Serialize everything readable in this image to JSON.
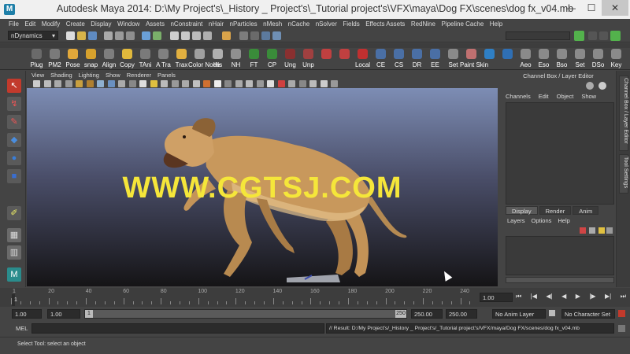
{
  "window": {
    "title": "Autodesk Maya 2014: D:\\My Project's\\_History _ Project's\\_Tutorial project's\\VFX\\maya\\Dog FX\\scenes\\dog fx_v04.mb",
    "minimize": "—",
    "maximize": "☐",
    "close": "✕"
  },
  "menubar": [
    "File",
    "Edit",
    "Modify",
    "Create",
    "Display",
    "Window",
    "Assets",
    "nConstraint",
    "nHair",
    "nParticles",
    "nMesh",
    "nCache",
    "nSolver",
    "Fields",
    "Effects Assets",
    "RedNine",
    "Pipeline Cache",
    "Help"
  ],
  "statusline": {
    "menuset": "nDynamics"
  },
  "shelf": [
    {
      "label": "Plug",
      "color": "#6a6a6a"
    },
    {
      "label": "PM2",
      "color": "#7a7a7a"
    },
    {
      "label": "Pose",
      "color": "#e2a83a"
    },
    {
      "label": "snap",
      "color": "#d6a12d"
    },
    {
      "label": "Align",
      "color": "#7e7e7e"
    },
    {
      "label": "Copy",
      "color": "#e0b83c"
    },
    {
      "label": "TAni",
      "color": "#7a7a7a"
    },
    {
      "label": "A Tra",
      "color": "#808080"
    },
    {
      "label": "Trax",
      "color": "#e2b040"
    },
    {
      "label": "Color Node",
      "color": "#a0a0a0"
    },
    {
      "label": "His",
      "color": "#b0b0b0"
    },
    {
      "label": "NH",
      "color": "#909090"
    },
    {
      "label": "FT",
      "color": "#3a8c3a"
    },
    {
      "label": "CP",
      "color": "#3a8c3a"
    },
    {
      "label": "Ung",
      "color": "#8a3030"
    },
    {
      "label": "Unp",
      "color": "#a04040"
    },
    {
      "label": "",
      "color": "#c04040"
    },
    {
      "label": "",
      "color": "#c04040"
    },
    {
      "label": "Local",
      "color": "#c03030"
    },
    {
      "label": "CE",
      "color": "#4a6fa5"
    },
    {
      "label": "CS",
      "color": "#4a6fa5"
    },
    {
      "label": "DR",
      "color": "#4a6fa5"
    },
    {
      "label": "EE",
      "color": "#4a6fa5"
    },
    {
      "label": "Set",
      "color": "#8a8a8a"
    },
    {
      "label": "Paint Skin",
      "color": "#c07070"
    },
    {
      "label": "",
      "color": "#2f7fc4"
    },
    {
      "label": "",
      "color": "#2f6fb4"
    },
    {
      "label": "Aeo",
      "color": "#8a8a8a"
    },
    {
      "label": "Eso",
      "color": "#8a8a8a"
    },
    {
      "label": "Bso",
      "color": "#8a8a8a"
    },
    {
      "label": "Set",
      "color": "#8a8a8a"
    },
    {
      "label": "DSo",
      "color": "#8a8a8a"
    },
    {
      "label": "Key",
      "color": "#8a8a8a"
    }
  ],
  "viewport": {
    "menu": [
      "View",
      "Shading",
      "Lighting",
      "Show",
      "Renderer",
      "Panels"
    ],
    "watermark": "WWW.CGTSJ.COM"
  },
  "channelbox": {
    "title": "Channel Box / Layer Editor",
    "menu": [
      "Channels",
      "Edit",
      "Object",
      "Show"
    ],
    "layer_tabs": [
      "Display",
      "Render",
      "Anim"
    ],
    "layer_menu": [
      "Layers",
      "Options",
      "Help"
    ]
  },
  "side_tabs": [
    "Channel Box / Layer Editor",
    "Tool Settings"
  ],
  "timeslider": {
    "ticks": [
      "1",
      "20",
      "40",
      "60",
      "80",
      "100",
      "120",
      "140",
      "160",
      "180",
      "200",
      "220",
      "240"
    ],
    "current_frame": "1.00",
    "current_frame_marker": "1"
  },
  "rangeslider": {
    "start": "1.00",
    "playback_start": "1.00",
    "range_start_box": "1",
    "range_end_box": "250",
    "playback_end": "250.00",
    "end": "250.00",
    "anim_layer": "No Anim Layer",
    "character_set": "No Character Set"
  },
  "commandline": {
    "label": "MEL",
    "result": "// Result: D:/My Project's/_History _ Project's/_Tutorial project's/VFX/maya/Dog FX/scenes/dog fx_v04.mb"
  },
  "helpline": {
    "text": "Select Tool: select an object"
  }
}
